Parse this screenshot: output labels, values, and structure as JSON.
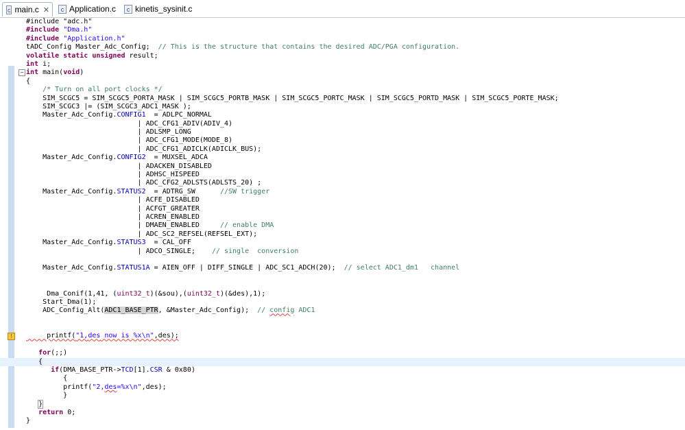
{
  "tabs": [
    {
      "label": "main.c",
      "icon": "c-file-icon",
      "close": "✕",
      "active": true
    },
    {
      "label": "Application.c",
      "icon": "c-file-icon",
      "active": false
    },
    {
      "label": "kinetis_sysinit.c",
      "icon": "c-file-icon",
      "active": false
    }
  ],
  "code": {
    "l0": "#include \"adc.h\"",
    "l1a": "#include ",
    "l1b": "\"Dma.h\"",
    "l2a": "#include ",
    "l2b": "\"Application.h\"",
    "l3a": "tADC_Config Master_Adc_Config;  ",
    "l3b": "// This is the structure that contains the desired ADC/PGA configuration.",
    "l4a": "volatile static unsigned",
    "l4b": " result;",
    "l5a": "int",
    "l5b": " i;",
    "l6a": "int",
    "l6b": " main(",
    "l6c": "void",
    "l6d": ")",
    "l7": "{",
    "l8": "    /* Turn on all port clocks */",
    "l9": "    SIM_SCGC5 = SIM_SCGC5_PORTA_MASK | SIM_SCGC5_PORTB_MASK | SIM_SCGC5_PORTC_MASK | SIM_SCGC5_PORTD_MASK | SIM_SCGC5_PORTE_MASK;",
    "l10": "    SIM_SCGC3 |= (SIM_SCGC3_ADC1_MASK );",
    "l11a": "    Master_Adc_Config.",
    "l11b": "CONFIG1",
    "l11c": "  = ADLPC_NORMAL",
    "l12": "                           | ADC_CFG1_ADIV(ADIV_4)",
    "l13": "                           | ADLSMP_LONG",
    "l14": "                           | ADC_CFG1_MODE(MODE_8)",
    "l15": "                           | ADC_CFG1_ADICLK(ADICLK_BUS);",
    "l16a": "    Master_Adc_Config.",
    "l16b": "CONFIG2",
    "l16c": "  = MUXSEL_ADCA",
    "l17": "                           | ADACKEN_DISABLED",
    "l18": "                           | ADHSC_HISPEED",
    "l19": "                           | ADC_CFG2_ADLSTS(ADLSTS_20) ;",
    "l20a": "    Master_Adc_Config.",
    "l20b": "STATUS2",
    "l20c": "  = ADTRG_SW      ",
    "l20d": "//SW trigger",
    "l21": "                           | ACFE_DISABLED",
    "l22": "                           | ACFGT_GREATER",
    "l23": "                           | ACREN_ENABLED",
    "l24a": "                           | DMAEN_ENABLED     ",
    "l24b": "// enable DMA",
    "l25": "                           | ADC_SC2_REFSEL(REFSEL_EXT);",
    "l26a": "    Master_Adc_Config.",
    "l26b": "STATUS3",
    "l26c": "  = CAL_OFF",
    "l27a": "                           | ADCO_SINGLE;    ",
    "l27b": "// single  conversion",
    "l29a": "    Master_Adc_Config.",
    "l29b": "STATUS1A",
    "l29c": " = AIEN_OFF | DIFF_SINGLE | ADC_SC1_ADCH(20);  ",
    "l29d": "// select ADC1_dm1   channel",
    "l32a": "     Dma_Conif(1,41, (",
    "l32b": "uint32_t",
    "l32c": ")(&sou),(",
    "l32d": "uint32_t",
    "l32e": ")(&des),1);",
    "l33": "    Start_Dma(1);",
    "l34a": "    ADC_Config_Alt(",
    "l34b": "ADC1_BASE_PTR",
    "l34c": ", &Master_Adc_Config);  ",
    "l34d": "// ",
    "l34e": "config",
    "l34f": " ADC1",
    "l37a": "     printf(",
    "l37b": "\"1,",
    "l37c": "des",
    "l37d": " now is %x\\n\"",
    "l37e": ",des);",
    "l39a": "   ",
    "l39b": "for",
    "l39c": "(;;)",
    "l40": "   {",
    "l41a": "      ",
    "l41b": "if",
    "l41c": "(DMA_BASE_PTR->",
    "l41d": "TCD",
    "l41e": "[1].",
    "l41f": "CSR",
    "l41g": " & 0x80)",
    "l42": "         {",
    "l43a": "         printf(",
    "l43b": "\"2,",
    "l43c": "des",
    "l43d": "=%x\\n\"",
    "l43e": ",des);",
    "l44": "         }",
    "l45a": "   ",
    "l45b": "}",
    "l46a": "   ",
    "l46b": "return",
    "l46c": " 0;",
    "l47": "}"
  },
  "colors": {
    "keyword": "#7f0055",
    "string": "#2a00ff",
    "comment": "#3f7f5f",
    "field": "#0000c0",
    "current_line": "#e8f2fe"
  }
}
